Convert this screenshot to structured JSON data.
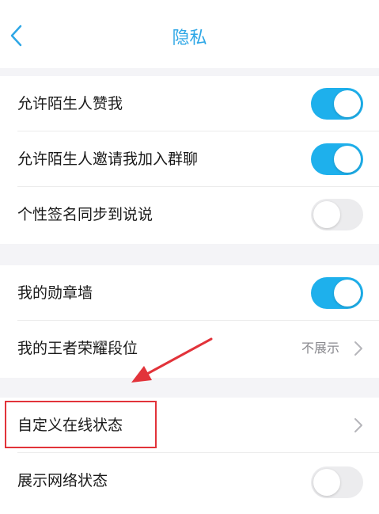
{
  "nav": {
    "title": "隐私",
    "back_icon": "chevron-left-icon"
  },
  "colors": {
    "accent": "#1eb0ec",
    "title": "#2ea7e6",
    "annotation": "#e2333a"
  },
  "settings": {
    "group1": [
      {
        "label": "允许陌生人赞我",
        "toggle": true
      },
      {
        "label": "允许陌生人邀请我加入群聊",
        "toggle": true
      },
      {
        "label": "个性签名同步到说说",
        "toggle": false
      }
    ],
    "group2": [
      {
        "label": "我的勋章墙",
        "toggle": true
      },
      {
        "label": "我的王者荣耀段位",
        "value": "不展示"
      }
    ],
    "group3": [
      {
        "label": "自定义在线状态"
      },
      {
        "label": "展示网络状态",
        "toggle": false
      }
    ]
  }
}
